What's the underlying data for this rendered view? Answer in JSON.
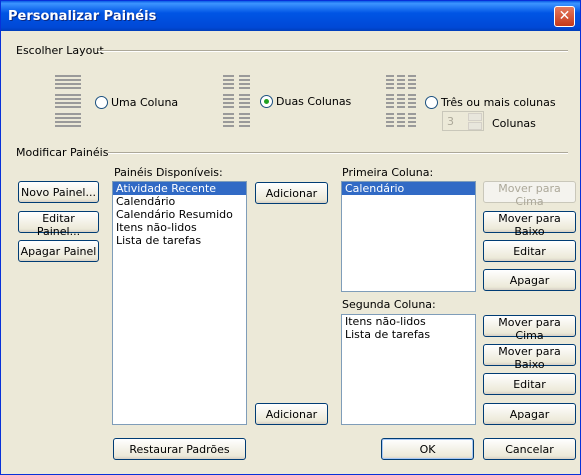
{
  "window": {
    "title": "Personalizar Painéis"
  },
  "layout_group": {
    "label": "Escolher Layout",
    "options": [
      {
        "label": "Uma Coluna",
        "checked": false
      },
      {
        "label": "Duas Colunas",
        "checked": true
      },
      {
        "label": "Três ou mais colunas",
        "checked": false
      }
    ],
    "columns_count": "3",
    "columns_label": "Colunas"
  },
  "panels_group": {
    "label": "Modificar Painéis",
    "new_button": "Novo Painel...",
    "edit_button": "Editar Painel...",
    "delete_button": "Apagar Painel",
    "available_label": "Painéis Disponíveis:",
    "available_items": [
      "Atividade Recente",
      "Calendário",
      "Calendário Resumido",
      "Itens não-lidos",
      "Lista de tarefas"
    ],
    "add_button_1": "Adicionar",
    "add_button_2": "Adicionar",
    "first_column_label": "Primeira Coluna:",
    "first_column_items": [
      "Calendário"
    ],
    "second_column_label": "Segunda Coluna:",
    "second_column_items": [
      "Itens não-lidos",
      "Lista de tarefas"
    ],
    "move_up": "Mover para Cima",
    "move_down": "Mover para Baixo",
    "edit": "Editar",
    "delete": "Apagar"
  },
  "footer": {
    "restore_button": "Restaurar Padrões",
    "ok_button": "OK",
    "cancel_button": "Cancelar"
  }
}
